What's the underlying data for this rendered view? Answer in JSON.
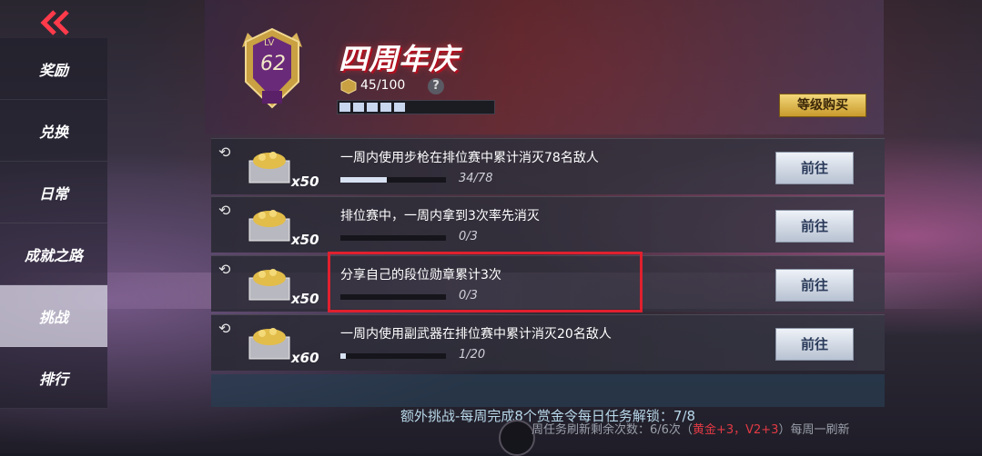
{
  "sidebar": {
    "items": [
      {
        "label": "奖励"
      },
      {
        "label": "兑换"
      },
      {
        "label": "日常"
      },
      {
        "label": "成就之路"
      },
      {
        "label": "挑战",
        "active": true
      },
      {
        "label": "排行"
      }
    ]
  },
  "header": {
    "lv_label": "LV",
    "level": "62",
    "title": "四周年庆",
    "progress_text": "45/100",
    "progress_segments_filled": 5,
    "help_symbol": "?",
    "buy_label": "等级购买"
  },
  "tasks": [
    {
      "description": "一周内使用步枪在排位赛中累计消灭78名敌人",
      "quantity": "x50",
      "progress_text": "34/78",
      "progress": 0.436,
      "button": "前往"
    },
    {
      "description": "排位赛中，一周内拿到3次率先消灭",
      "quantity": "x50",
      "progress_text": "0/3",
      "progress": 0.0,
      "button": "前往"
    },
    {
      "description": "分享自己的段位勋章累计3次",
      "quantity": "x50",
      "progress_text": "0/3",
      "progress": 0.0,
      "button": "前往"
    },
    {
      "description": "一周内使用副武器在排位赛中累计消灭20名敌人",
      "quantity": "x60",
      "progress_text": "1/20",
      "progress": 0.05,
      "button": "前往"
    }
  ],
  "footer": {
    "extra_challenge": "额外挑战-每周完成8个赏金令每日任务解锁：7/8",
    "refresh_prefix": "周任务刷新剩余次数：6/6次（",
    "refresh_highlight": "黄金+3，V2+3",
    "refresh_suffix": "）每周一刷新"
  },
  "colors": {
    "accent_red": "#e0202e",
    "gold": "#e8c45a",
    "text_light_blue": "#b8d8ea"
  }
}
